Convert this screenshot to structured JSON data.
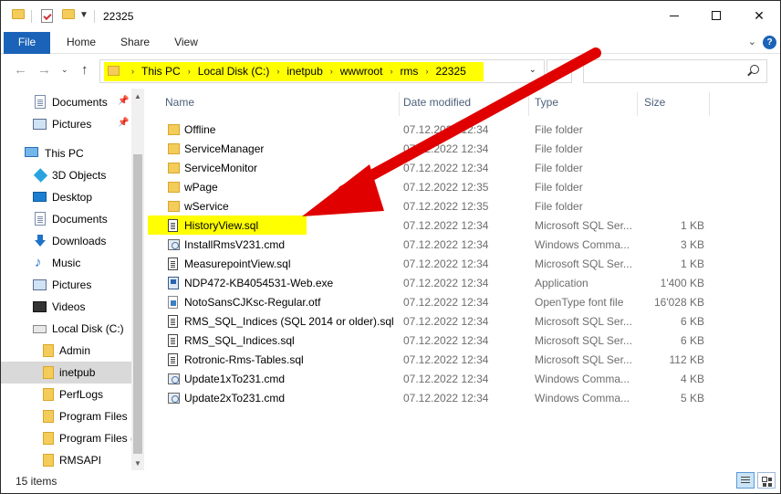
{
  "window": {
    "title": "22325"
  },
  "ribbon": {
    "tabs": [
      "File",
      "Home",
      "Share",
      "View"
    ]
  },
  "address": {
    "crumbs": [
      "This PC",
      "Local Disk (C:)",
      "inetpub",
      "wwwroot",
      "rms",
      "22325"
    ]
  },
  "search": {
    "placeholder": ""
  },
  "sidebar": {
    "items": [
      {
        "label": "Documents",
        "icon": "documents-icon",
        "pinned": true
      },
      {
        "label": "Pictures",
        "icon": "pictures-icon",
        "pinned": true
      },
      {
        "label": "This PC",
        "icon": "pc-icon"
      },
      {
        "label": "3D Objects",
        "icon": "3d-objects-icon"
      },
      {
        "label": "Desktop",
        "icon": "desktop-icon"
      },
      {
        "label": "Documents",
        "icon": "documents-icon"
      },
      {
        "label": "Downloads",
        "icon": "downloads-icon"
      },
      {
        "label": "Music",
        "icon": "music-icon"
      },
      {
        "label": "Pictures",
        "icon": "pictures-icon"
      },
      {
        "label": "Videos",
        "icon": "videos-icon"
      },
      {
        "label": "Local Disk (C:)",
        "icon": "disk-icon"
      },
      {
        "label": "Admin",
        "icon": "folder-icon"
      },
      {
        "label": "inetpub",
        "icon": "folder-icon",
        "selected": true
      },
      {
        "label": "PerfLogs",
        "icon": "folder-icon"
      },
      {
        "label": "Program Files",
        "icon": "folder-icon"
      },
      {
        "label": "Program Files (",
        "icon": "folder-icon"
      },
      {
        "label": "RMSAPI",
        "icon": "folder-icon"
      }
    ]
  },
  "columns": {
    "name": "Name",
    "date": "Date modified",
    "type": "Type",
    "size": "Size"
  },
  "files": [
    {
      "name": "Offline",
      "date": "07.12.2022 12:34",
      "type": "File folder",
      "size": "",
      "kind": "folder"
    },
    {
      "name": "ServiceManager",
      "date": "07.12.2022 12:34",
      "type": "File folder",
      "size": "",
      "kind": "folder"
    },
    {
      "name": "ServiceMonitor",
      "date": "07.12.2022 12:34",
      "type": "File folder",
      "size": "",
      "kind": "folder"
    },
    {
      "name": "wPage",
      "date": "07.12.2022 12:35",
      "type": "File folder",
      "size": "",
      "kind": "folder"
    },
    {
      "name": "wService",
      "date": "07.12.2022 12:35",
      "type": "File folder",
      "size": "",
      "kind": "folder"
    },
    {
      "name": "HistoryView.sql",
      "date": "07.12.2022 12:34",
      "type": "Microsoft SQL Ser...",
      "size": "1 KB",
      "kind": "sql",
      "highlighted": true
    },
    {
      "name": "InstallRmsV231.cmd",
      "date": "07.12.2022 12:34",
      "type": "Windows Comma...",
      "size": "3 KB",
      "kind": "cmd"
    },
    {
      "name": "MeasurepointView.sql",
      "date": "07.12.2022 12:34",
      "type": "Microsoft SQL Ser...",
      "size": "1 KB",
      "kind": "sql"
    },
    {
      "name": "NDP472-KB4054531-Web.exe",
      "date": "07.12.2022 12:34",
      "type": "Application",
      "size": "1'400 KB",
      "kind": "exe"
    },
    {
      "name": "NotoSansCJKsc-Regular.otf",
      "date": "07.12.2022 12:34",
      "type": "OpenType font file",
      "size": "16'028 KB",
      "kind": "otf"
    },
    {
      "name": "RMS_SQL_Indices (SQL 2014 or older).sql",
      "date": "07.12.2022 12:34",
      "type": "Microsoft SQL Ser...",
      "size": "6 KB",
      "kind": "sql"
    },
    {
      "name": "RMS_SQL_Indices.sql",
      "date": "07.12.2022 12:34",
      "type": "Microsoft SQL Ser...",
      "size": "6 KB",
      "kind": "sql"
    },
    {
      "name": "Rotronic-Rms-Tables.sql",
      "date": "07.12.2022 12:34",
      "type": "Microsoft SQL Ser...",
      "size": "112 KB",
      "kind": "sql"
    },
    {
      "name": "Update1xTo231.cmd",
      "date": "07.12.2022 12:34",
      "type": "Windows Comma...",
      "size": "4 KB",
      "kind": "cmd"
    },
    {
      "name": "Update2xTo231.cmd",
      "date": "07.12.2022 12:34",
      "type": "Windows Comma...",
      "size": "5 KB",
      "kind": "cmd"
    }
  ],
  "status": {
    "count": "15 items"
  },
  "colors": {
    "accent": "#1a63b8",
    "highlight": "#ffff00",
    "annotation_arrow": "#e00000"
  }
}
